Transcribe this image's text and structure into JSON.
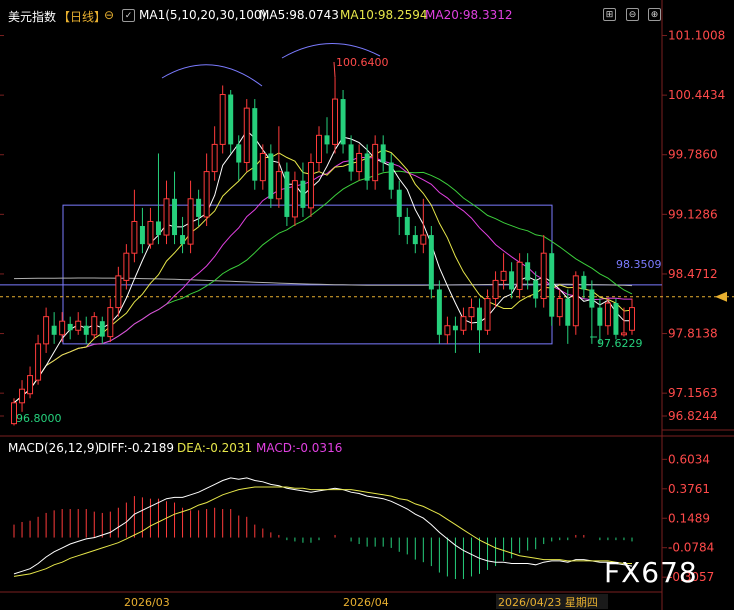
{
  "header": {
    "title": "美元指数",
    "period": "【日线】",
    "ma_label": "MA1(5,10,20,30,100)",
    "ma5": "MA5:98.0743",
    "ma10": "MA10:98.2594",
    "ma20": "MA20:98.3312"
  },
  "macd_header": {
    "label": "MACD(26,12,9)",
    "diff": "DIFF:-0.2189",
    "dea": "DEA:-0.2031",
    "macd": "MACD:-0.0316"
  },
  "x_labels": [
    "2026/03",
    "2026/04",
    "2026/04/23 星期四"
  ],
  "watermark": "FX678",
  "colors": {
    "up": "#ff3b3b",
    "down": "#26d07c",
    "ma5": "#ffffff",
    "ma10": "#e6e64a",
    "ma20": "#e040e0",
    "ma30": "#3ccf3c",
    "ma100": "#b0b0b0",
    "box": "#7b7bff"
  },
  "chart_data": [
    {
      "type": "candlestick",
      "title": "美元指数【日线】",
      "y_ticks": [
        "101.1008",
        "100.4434",
        "99.7860",
        "99.1286",
        "98.4712",
        "97.8138",
        "97.1563",
        "96.8244"
      ],
      "ylim": [
        96.75,
        101.25
      ],
      "annotations": {
        "high": "100.6400",
        "low_start": "96.8000",
        "low_recent": "97.6229",
        "last_price": "98.3509"
      },
      "candles": [
        [
          96.82,
          97.05,
          96.8,
          97.1
        ],
        [
          97.05,
          97.2,
          96.95,
          97.3
        ],
        [
          97.15,
          97.35,
          97.1,
          97.45
        ],
        [
          97.3,
          97.7,
          97.25,
          97.8
        ],
        [
          97.7,
          98.0,
          97.6,
          98.1
        ],
        [
          97.9,
          97.8,
          97.7,
          98.05
        ],
        [
          97.8,
          97.95,
          97.72,
          98.05
        ],
        [
          97.92,
          97.85,
          97.75,
          98.0
        ],
        [
          97.85,
          97.95,
          97.8,
          98.05
        ],
        [
          97.9,
          97.8,
          97.7,
          98.0
        ],
        [
          97.8,
          98.0,
          97.75,
          98.05
        ],
        [
          97.95,
          97.78,
          97.7,
          98.0
        ],
        [
          97.78,
          98.1,
          97.72,
          98.2
        ],
        [
          98.1,
          98.45,
          98.0,
          98.55
        ],
        [
          98.4,
          98.7,
          98.3,
          98.8
        ],
        [
          98.7,
          99.05,
          98.6,
          99.4
        ],
        [
          99.0,
          98.8,
          98.7,
          99.2
        ],
        [
          98.8,
          99.05,
          98.75,
          99.2
        ],
        [
          99.05,
          98.9,
          98.8,
          99.8
        ],
        [
          98.9,
          99.3,
          98.8,
          99.5
        ],
        [
          99.3,
          98.9,
          98.8,
          99.6
        ],
        [
          98.9,
          98.8,
          98.7,
          99.1
        ],
        [
          98.8,
          99.3,
          98.7,
          99.5
        ],
        [
          99.3,
          99.1,
          99.0,
          99.4
        ],
        [
          99.1,
          99.6,
          99.0,
          99.8
        ],
        [
          99.6,
          99.9,
          99.5,
          100.1
        ],
        [
          99.9,
          100.45,
          99.8,
          100.55
        ],
        [
          100.45,
          99.9,
          99.8,
          100.5
        ],
        [
          99.9,
          99.7,
          99.5,
          100.0
        ],
        [
          99.7,
          100.3,
          99.6,
          100.4
        ],
        [
          100.3,
          99.5,
          99.4,
          100.4
        ],
        [
          99.5,
          99.8,
          99.4,
          99.9
        ],
        [
          99.8,
          99.3,
          99.2,
          99.9
        ],
        [
          99.3,
          99.6,
          99.2,
          100.1
        ],
        [
          99.6,
          99.1,
          99.0,
          99.7
        ],
        [
          99.1,
          99.5,
          99.0,
          99.6
        ],
        [
          99.5,
          99.2,
          99.1,
          99.7
        ],
        [
          99.2,
          99.7,
          99.1,
          99.8
        ],
        [
          99.7,
          100.0,
          99.6,
          100.1
        ],
        [
          100.0,
          99.9,
          99.8,
          100.2
        ],
        [
          99.9,
          100.4,
          99.8,
          100.64
        ],
        [
          100.4,
          99.9,
          99.8,
          100.5
        ],
        [
          99.9,
          99.6,
          99.5,
          100.0
        ],
        [
          99.6,
          99.8,
          99.5,
          99.9
        ],
        [
          99.8,
          99.5,
          99.4,
          99.9
        ],
        [
          99.5,
          99.9,
          99.4,
          100.0
        ],
        [
          99.9,
          99.7,
          99.6,
          100.0
        ],
        [
          99.7,
          99.4,
          99.3,
          99.8
        ],
        [
          99.4,
          99.1,
          98.9,
          99.5
        ],
        [
          99.1,
          98.9,
          98.8,
          99.2
        ],
        [
          98.9,
          98.8,
          98.7,
          99.0
        ],
        [
          98.8,
          98.9,
          98.7,
          99.3
        ],
        [
          98.9,
          98.3,
          98.2,
          99.0
        ],
        [
          98.3,
          97.8,
          97.7,
          98.4
        ],
        [
          97.8,
          97.9,
          97.7,
          98.0
        ],
        [
          97.9,
          97.85,
          97.6,
          98.0
        ],
        [
          97.85,
          98.0,
          97.8,
          98.1
        ],
        [
          98.0,
          98.1,
          97.85,
          98.2
        ],
        [
          98.1,
          97.85,
          97.6,
          98.2
        ],
        [
          97.85,
          98.2,
          97.8,
          98.3
        ],
        [
          98.2,
          98.4,
          98.1,
          98.5
        ],
        [
          98.4,
          98.5,
          98.3,
          98.7
        ],
        [
          98.5,
          98.3,
          98.2,
          98.6
        ],
        [
          98.3,
          98.6,
          98.2,
          98.7
        ],
        [
          98.6,
          98.4,
          98.3,
          98.7
        ],
        [
          98.4,
          98.2,
          98.1,
          98.5
        ],
        [
          98.2,
          98.7,
          98.1,
          98.9
        ],
        [
          98.7,
          98.0,
          97.9,
          98.8
        ],
        [
          98.0,
          98.2,
          97.9,
          98.3
        ],
        [
          98.2,
          97.9,
          97.7,
          98.3
        ],
        [
          97.9,
          98.45,
          97.8,
          98.5
        ],
        [
          98.45,
          98.3,
          98.2,
          98.5
        ],
        [
          98.3,
          98.1,
          97.7,
          98.4
        ],
        [
          98.1,
          97.9,
          97.7,
          98.2
        ],
        [
          97.9,
          98.15,
          97.8,
          98.2
        ],
        [
          98.15,
          97.8,
          97.75,
          98.2
        ],
        [
          97.8,
          97.82,
          97.78,
          98.1
        ],
        [
          97.85,
          98.1,
          97.8,
          98.2
        ]
      ]
    },
    {
      "type": "macd",
      "title": "MACD(26,12,9)",
      "y_ticks": [
        "0.6034",
        "0.3761",
        "0.1489",
        "-0.0784",
        "-0.3057"
      ],
      "ylim": [
        -0.42,
        0.66
      ],
      "series": [
        {
          "name": "DIFF",
          "values": [
            -0.28,
            -0.26,
            -0.24,
            -0.2,
            -0.15,
            -0.11,
            -0.08,
            -0.05,
            -0.03,
            -0.01,
            0.0,
            0.02,
            0.04,
            0.08,
            0.12,
            0.18,
            0.21,
            0.24,
            0.27,
            0.3,
            0.31,
            0.31,
            0.33,
            0.35,
            0.38,
            0.41,
            0.44,
            0.46,
            0.45,
            0.46,
            0.44,
            0.43,
            0.41,
            0.4,
            0.38,
            0.37,
            0.36,
            0.35,
            0.36,
            0.37,
            0.38,
            0.37,
            0.35,
            0.34,
            0.32,
            0.31,
            0.3,
            0.28,
            0.25,
            0.22,
            0.18,
            0.15,
            0.1,
            0.04,
            -0.01,
            -0.06,
            -0.1,
            -0.13,
            -0.16,
            -0.18,
            -0.19,
            -0.19,
            -0.2,
            -0.2,
            -0.2,
            -0.21,
            -0.19,
            -0.18,
            -0.18,
            -0.19,
            -0.17,
            -0.17,
            -0.18,
            -0.19,
            -0.19,
            -0.2,
            -0.21,
            -0.22
          ]
        },
        {
          "name": "DEA",
          "values": [
            -0.3,
            -0.29,
            -0.28,
            -0.26,
            -0.24,
            -0.21,
            -0.19,
            -0.16,
            -0.14,
            -0.12,
            -0.1,
            -0.08,
            -0.06,
            -0.04,
            -0.01,
            0.02,
            0.05,
            0.09,
            0.12,
            0.15,
            0.18,
            0.2,
            0.22,
            0.25,
            0.27,
            0.3,
            0.33,
            0.35,
            0.37,
            0.38,
            0.39,
            0.39,
            0.39,
            0.39,
            0.39,
            0.38,
            0.38,
            0.37,
            0.37,
            0.37,
            0.37,
            0.37,
            0.37,
            0.36,
            0.35,
            0.34,
            0.33,
            0.32,
            0.3,
            0.29,
            0.26,
            0.24,
            0.21,
            0.18,
            0.14,
            0.1,
            0.06,
            0.02,
            -0.02,
            -0.05,
            -0.08,
            -0.1,
            -0.12,
            -0.14,
            -0.15,
            -0.16,
            -0.17,
            -0.17,
            -0.17,
            -0.18,
            -0.18,
            -0.18,
            -0.18,
            -0.18,
            -0.18,
            -0.19,
            -0.2,
            -0.2
          ]
        },
        {
          "name": "MACD",
          "values": [
            0.1,
            0.12,
            0.13,
            0.16,
            0.19,
            0.21,
            0.22,
            0.22,
            0.22,
            0.22,
            0.2,
            0.19,
            0.2,
            0.23,
            0.27,
            0.32,
            0.31,
            0.3,
            0.3,
            0.28,
            0.27,
            0.23,
            0.21,
            0.21,
            0.22,
            0.23,
            0.22,
            0.22,
            0.17,
            0.16,
            0.1,
            0.07,
            0.04,
            0.02,
            -0.02,
            -0.03,
            -0.04,
            -0.04,
            -0.02,
            0.0,
            0.02,
            0.0,
            -0.03,
            -0.05,
            -0.07,
            -0.07,
            -0.07,
            -0.08,
            -0.11,
            -0.13,
            -0.17,
            -0.19,
            -0.22,
            -0.27,
            -0.3,
            -0.32,
            -0.32,
            -0.3,
            -0.28,
            -0.25,
            -0.22,
            -0.18,
            -0.16,
            -0.12,
            -0.1,
            -0.09,
            -0.05,
            -0.03,
            -0.02,
            -0.02,
            0.02,
            0.02,
            0.0,
            -0.02,
            -0.02,
            -0.02,
            -0.02,
            -0.03
          ]
        }
      ]
    }
  ]
}
